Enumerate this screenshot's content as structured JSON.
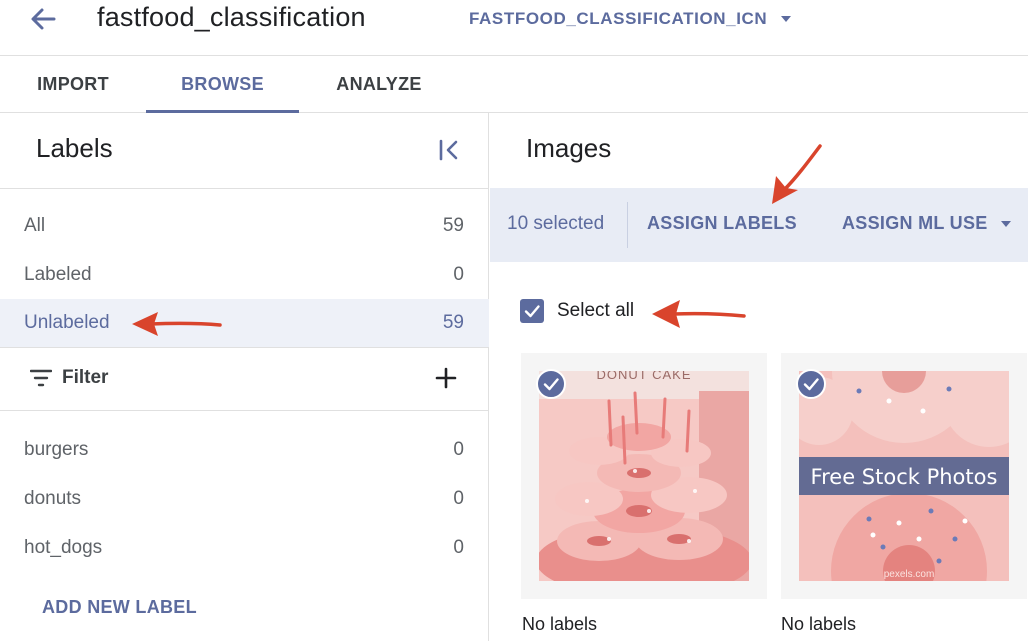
{
  "header": {
    "title": "fastfood_classification",
    "model_selector": "FASTFOOD_CLASSIFICATION_ICN"
  },
  "tabs": [
    {
      "label": "IMPORT",
      "active": false
    },
    {
      "label": "BROWSE",
      "active": true
    },
    {
      "label": "ANALYZE",
      "active": false
    }
  ],
  "labels_panel": {
    "title": "Labels",
    "filters": [
      {
        "name": "All",
        "count": "59"
      },
      {
        "name": "Labeled",
        "count": "0"
      },
      {
        "name": "Unlabeled",
        "count": "59",
        "selected": true
      }
    ],
    "filter_label": "Filter",
    "labels": [
      {
        "name": "burgers",
        "count": "0"
      },
      {
        "name": "donuts",
        "count": "0"
      },
      {
        "name": "hot_dogs",
        "count": "0"
      }
    ],
    "add_label": "ADD NEW LABEL"
  },
  "images_panel": {
    "title": "Images",
    "selected_text": "10 selected",
    "assign_labels": "ASSIGN LABELS",
    "assign_ml_use": "ASSIGN ML USE",
    "select_all": "Select all",
    "select_all_checked": true,
    "cards": [
      {
        "caption": "No labels",
        "overlay_text": "DONUT CAKE",
        "checked": true
      },
      {
        "caption": "No labels",
        "overlay_text": "Free Stock Photos",
        "watermark": "pexels.com",
        "checked": true
      }
    ]
  },
  "colors": {
    "accent": "#5c6b9e",
    "selected_row_bg": "#eef1f8",
    "action_bar_bg": "#e8ecf5",
    "annotation_arrow": "#d9442c"
  }
}
